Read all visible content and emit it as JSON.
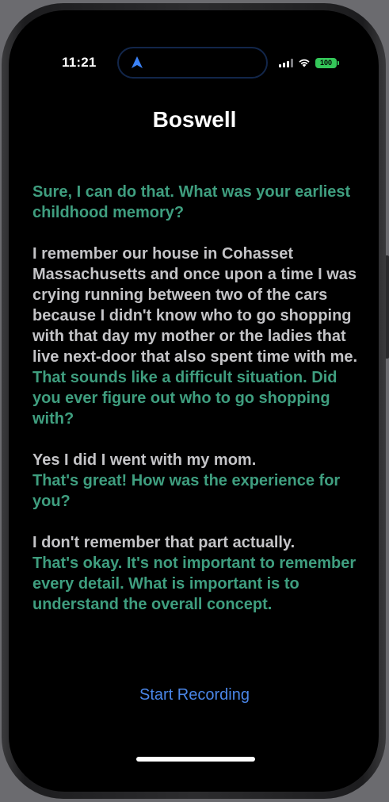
{
  "status_bar": {
    "time": "11:21",
    "battery": "100",
    "icons": [
      "location-arrow-icon",
      "cellular-signal-icon",
      "wifi-icon",
      "battery-icon"
    ],
    "battery_color": "#34c759"
  },
  "app": {
    "title": "Boswell"
  },
  "transcript": [
    {
      "role": "ai",
      "text": "Sure, I can do that. What was your earliest childhood memory?"
    },
    {
      "role": "user",
      "text": "I remember our house in Cohasset Massachusetts and once upon a time I was crying running between two of the cars because I didn't know who to go shopping with that day my mother or the ladies that live next-door that also spent time with me."
    },
    {
      "role": "ai",
      "text": "That sounds like a difficult situation. Did you ever figure out who to go shopping with?"
    },
    {
      "role": "user",
      "text": "Yes I did I went with my mom."
    },
    {
      "role": "ai",
      "text": "That's great! How was the experience for you?"
    },
    {
      "role": "user",
      "text": "I don't remember that part actually."
    },
    {
      "role": "ai",
      "text": "That's okay. It's not important to remember every detail. What is important is to understand the overall concept."
    }
  ],
  "controls": {
    "record_label": "Start Recording"
  },
  "colors": {
    "ai_text": "#3f9e7f",
    "user_text": "#c4c4c7",
    "accent": "#4a86e8",
    "background": "#000000"
  }
}
